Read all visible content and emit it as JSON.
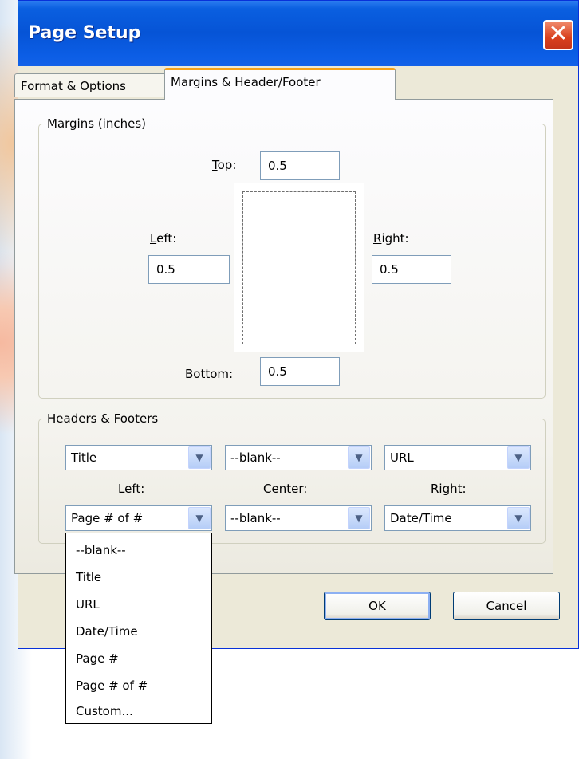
{
  "window": {
    "title": "Page Setup",
    "close_symbol": "✕"
  },
  "tabs": [
    {
      "label": "Format & Options",
      "active": false
    },
    {
      "label": "Margins & Header/Footer",
      "active": true
    }
  ],
  "margins_group": {
    "legend": "Margins (inches)",
    "top": {
      "label_u": "T",
      "label_rest": "op:",
      "value": "0.5"
    },
    "left": {
      "label_u": "L",
      "label_rest": "eft:",
      "value": "0.5"
    },
    "right": {
      "label_u": "R",
      "label_rest": "ight:",
      "value": "0.5"
    },
    "bottom": {
      "label_u": "B",
      "label_rest": "ottom:",
      "value": "0.5"
    }
  },
  "headers_footers_group": {
    "legend": "Headers & Footers",
    "header_left": "Title",
    "header_center": "--blank--",
    "header_right": "URL",
    "col_left_label": "Left:",
    "col_center_label": "Center:",
    "col_right_label": "Right:",
    "footer_left": "Page # of #",
    "footer_center": "--blank--",
    "footer_right": "Date/Time"
  },
  "dropdown_options": [
    "--blank--",
    "Title",
    "URL",
    "Date/Time",
    "Page #",
    "Page # of #",
    "Custom..."
  ],
  "buttons": {
    "ok": "OK",
    "cancel": "Cancel"
  },
  "icons": {
    "select_arrow": "chevron-down-icon"
  }
}
